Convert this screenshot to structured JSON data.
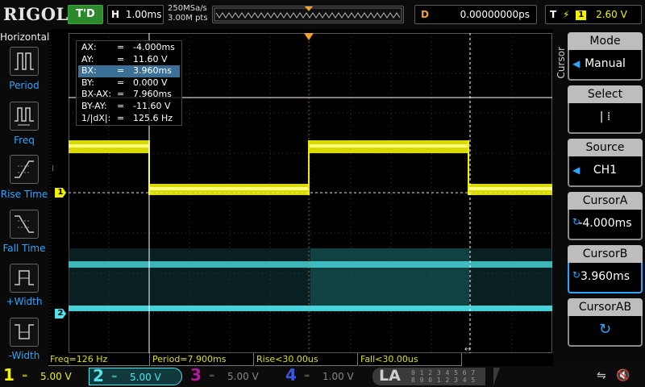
{
  "brand": "RIGOL",
  "run_state": "T'D",
  "timebase": {
    "label": "H",
    "value": "1.00ms"
  },
  "sample": {
    "rate": "250MSa/s",
    "points": "3.00M pts"
  },
  "memory": {
    "trigger_marker": "T"
  },
  "offset": {
    "label": "D",
    "value": "0.00000000ps"
  },
  "trigger": {
    "label": "T",
    "channel": "1",
    "level": "2.60 V"
  },
  "left_panel": {
    "title": "Horizontal",
    "items": [
      {
        "label": "Period",
        "icon": "period-icon"
      },
      {
        "label": "Freq",
        "icon": "freq-icon"
      },
      {
        "label": "Rise Time",
        "icon": "rise-time-icon"
      },
      {
        "label": "Fall Time",
        "icon": "fall-time-icon"
      },
      {
        "label": "+Width",
        "icon": "pos-width-icon"
      },
      {
        "label": "-Width",
        "icon": "neg-width-icon"
      }
    ]
  },
  "cursor_readout": [
    {
      "key": "AX:",
      "eq": "=",
      "value": "-4.000ms",
      "selected": false
    },
    {
      "key": "AY:",
      "eq": "=",
      "value": "11.60 V",
      "selected": false
    },
    {
      "key": "BX:",
      "eq": "=",
      "value": "3.960ms",
      "selected": true
    },
    {
      "key": "BY:",
      "eq": "=",
      "value": "0.000 V",
      "selected": false
    },
    {
      "key": "BX-AX:",
      "eq": "=",
      "value": "7.960ms",
      "selected": false
    },
    {
      "key": "BY-AY:",
      "eq": "=",
      "value": "-11.60 V",
      "selected": false
    },
    {
      "key": "1/|dX|:",
      "eq": "=",
      "value": "125.6 Hz",
      "selected": false
    }
  ],
  "markers": {
    "ch1": "1",
    "ch2": "2",
    "trigger_level": "T"
  },
  "right_panel": {
    "vertical_title": "Cursor",
    "items": [
      {
        "title": "Mode",
        "value": "Manual",
        "icon": "arrow-left-icon"
      },
      {
        "title": "Select",
        "value": "|  ⁞",
        "icon": ""
      },
      {
        "title": "Source",
        "value": "CH1",
        "icon": "arrow-left-icon"
      },
      {
        "title": "CursorA",
        "value": "-4.000ms",
        "icon": "knob-icon"
      },
      {
        "title": "CursorB",
        "value": "3.960ms",
        "icon": "knob-icon"
      },
      {
        "title": "CursorAB",
        "value": "",
        "icon": "knob-icon"
      }
    ]
  },
  "measurements": [
    {
      "text": "Freq=126 Hz"
    },
    {
      "text": "Period=7.900ms"
    },
    {
      "text": "Rise<30.00us"
    },
    {
      "text": "Fall<30.00us"
    }
  ],
  "channels": [
    {
      "num": "1",
      "coupling": "DC",
      "scale": "5.00 V"
    },
    {
      "num": "2",
      "coupling": "DC",
      "scale": "5.00 V"
    },
    {
      "num": "3",
      "coupling": "DC",
      "scale": "5.00 V"
    },
    {
      "num": "4",
      "coupling": "DC",
      "scale": "1.00 V"
    }
  ],
  "la": {
    "label": "LA",
    "row1": "0 1 2 3  4 5 6 7",
    "row2": "8 9 0 1  2 3 4 5"
  },
  "colors": {
    "ch1": "#f2f200",
    "ch2": "#4de6ec",
    "ch3": "#b01a96",
    "ch4": "#3b56e0",
    "accent": "#2aa6ff",
    "trigger": "#f0a030"
  }
}
